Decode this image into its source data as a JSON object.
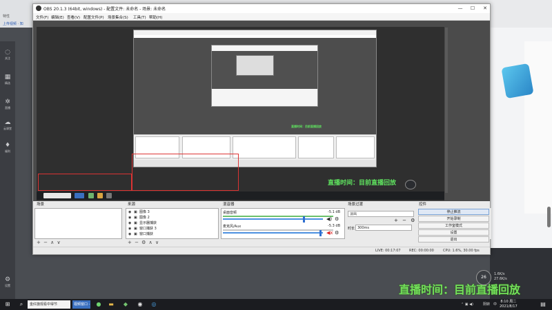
{
  "colors": {
    "accent_green": "#73e05a",
    "preview_bg": "#4b4b4b",
    "red_box": "#dd3333",
    "obs_chrome": "#eaeaea"
  },
  "background_app": {
    "line1": "特性",
    "line2": "上传视频 · 知",
    "rail": [
      {
        "icon": "chat-icon",
        "label": "关注"
      },
      {
        "icon": "grid-icon",
        "label": "精选"
      },
      {
        "icon": "gear-icon",
        "label": "直播"
      },
      {
        "icon": "cloud-icon",
        "label": "云课堂"
      },
      {
        "icon": "gift-icon",
        "label": "福利"
      },
      {
        "icon": "settings-icon",
        "label": "设置"
      }
    ]
  },
  "window": {
    "title": "OBS 20.1.3 (64bit, windows) - 配置文件: 未命名 - 场景: 未命名",
    "minimize": "—",
    "maximize": "☐",
    "close": "✕"
  },
  "menu": [
    "文件(F)",
    "编辑(E)",
    "查看(V)",
    "配置文件(P)",
    "场景集合(S)",
    "工具(T)",
    "帮助(H)"
  ],
  "inner_caption": "直播时间：目前直播回放",
  "inner_caption_small": "直播时间：目前直播回放",
  "docks": {
    "scenes": {
      "title": "场景",
      "tools": "+ − ∧ ∨"
    },
    "sources": {
      "title": "来源",
      "items": [
        "图像 3",
        "图像 2",
        "显示器捕获",
        "窗口捕获 3",
        "窗口捕获"
      ],
      "tools": "+ − ⚙ ∧ ∨"
    },
    "mixer": {
      "title": "混音器",
      "tracks": [
        {
          "name": "桌面音频",
          "db": "-5.1 dB"
        },
        {
          "name": "麦克风/Aux",
          "db": "-5.3 dB"
        }
      ]
    },
    "transitions": {
      "title": "场景过渡",
      "selected": "淡出",
      "duration_label": "时长",
      "duration_value": "300ms",
      "tools": "+ − ⚙"
    },
    "controls": {
      "title": "控件",
      "buttons": [
        "停止推流",
        "开始录制",
        "工作室模式",
        "设置",
        "退出"
      ]
    }
  },
  "status": {
    "live": "LIVE: 00:17:07",
    "rec": "REC: 00:00:00",
    "cpu": "CPU: 1.6%, 30.00 fps"
  },
  "overlay_caption": "直播时间：目前直播回放",
  "corner_badge": {
    "value": "26",
    "info1": "1.6K/s",
    "info2": "27.6K/s"
  },
  "taskbar": {
    "search_text": "金红旗观看中得节",
    "app_label": "视频窗口 - 1",
    "weather": "阴转",
    "lang": "中",
    "time": "8:10 周二",
    "date": "2021/8/17"
  }
}
